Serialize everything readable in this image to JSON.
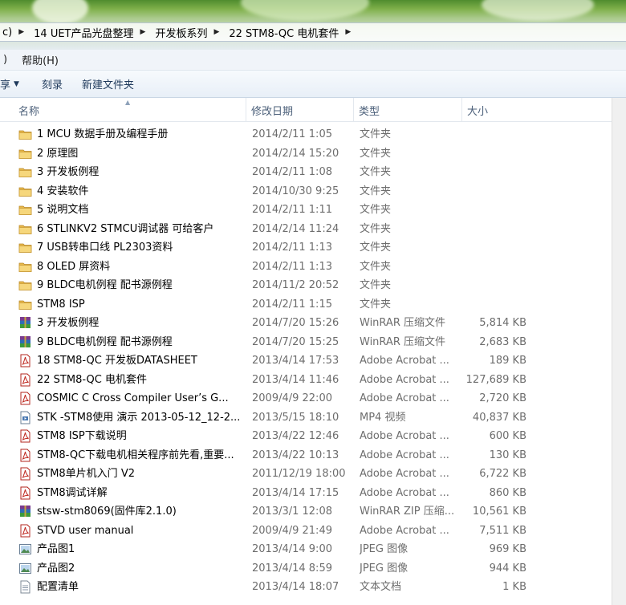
{
  "address": {
    "crumbs": [
      {
        "label": "c)"
      },
      {
        "label": "14 UET产品光盘整理"
      },
      {
        "label": "开发板系列"
      },
      {
        "label": "22 STM8-QC 电机套件"
      }
    ]
  },
  "menubar": {
    "items": [
      {
        "label": ")"
      },
      {
        "label": "帮助(H)"
      }
    ]
  },
  "toolbar": {
    "organize_fragment": "享",
    "burn": "刻录",
    "new_folder": "新建文件夹"
  },
  "columns": {
    "name": "名称",
    "date": "修改日期",
    "type": "类型",
    "size": "大小"
  },
  "files": [
    {
      "name": "1 MCU 数据手册及编程手册",
      "date": "2014/2/11 1:05",
      "type": "文件夹",
      "size": "",
      "icon": "folder-icon"
    },
    {
      "name": "2 原理图",
      "date": "2014/2/14 15:20",
      "type": "文件夹",
      "size": "",
      "icon": "folder-icon"
    },
    {
      "name": "3 开发板例程",
      "date": "2014/2/11 1:08",
      "type": "文件夹",
      "size": "",
      "icon": "folder-icon"
    },
    {
      "name": "4 安装软件",
      "date": "2014/10/30 9:25",
      "type": "文件夹",
      "size": "",
      "icon": "folder-icon"
    },
    {
      "name": "5 说明文档",
      "date": "2014/2/11 1:11",
      "type": "文件夹",
      "size": "",
      "icon": "folder-icon"
    },
    {
      "name": "6 STLINKV2 STMCU调试器 可给客户",
      "date": "2014/2/14 11:24",
      "type": "文件夹",
      "size": "",
      "icon": "folder-icon"
    },
    {
      "name": "7 USB转串口线 PL2303资料",
      "date": "2014/2/11 1:13",
      "type": "文件夹",
      "size": "",
      "icon": "folder-icon"
    },
    {
      "name": "8 OLED 屏资料",
      "date": "2014/2/11 1:13",
      "type": "文件夹",
      "size": "",
      "icon": "folder-icon"
    },
    {
      "name": "9 BLDC电机例程 配书源例程",
      "date": "2014/11/2 20:52",
      "type": "文件夹",
      "size": "",
      "icon": "folder-icon"
    },
    {
      "name": "STM8 ISP",
      "date": "2014/2/11 1:15",
      "type": "文件夹",
      "size": "",
      "icon": "folder-icon"
    },
    {
      "name": "3 开发板例程",
      "date": "2014/7/20 15:26",
      "type": "WinRAR 压缩文件",
      "size": "5,814 KB",
      "icon": "winrar-icon"
    },
    {
      "name": "9 BLDC电机例程 配书源例程",
      "date": "2014/7/20 15:25",
      "type": "WinRAR 压缩文件",
      "size": "2,683 KB",
      "icon": "winrar-icon"
    },
    {
      "name": "18 STM8-QC 开发板DATASHEET",
      "date": "2013/4/14 17:53",
      "type": "Adobe Acrobat ...",
      "size": "189 KB",
      "icon": "pdf-icon"
    },
    {
      "name": "22 STM8-QC 电机套件",
      "date": "2013/4/14 11:46",
      "type": "Adobe Acrobat ...",
      "size": "127,689 KB",
      "icon": "pdf-icon"
    },
    {
      "name": "COSMIC C Cross Compiler User’s G...",
      "date": "2009/4/9 22:00",
      "type": "Adobe Acrobat ...",
      "size": "2,720 KB",
      "icon": "pdf-icon"
    },
    {
      "name": "STK -STM8使用 演示 2013-05-12_12-2...",
      "date": "2013/5/15 18:10",
      "type": "MP4 视频",
      "size": "40,837 KB",
      "icon": "video-file-icon"
    },
    {
      "name": "STM8 ISP下载说明",
      "date": "2013/4/22 12:46",
      "type": "Adobe Acrobat ...",
      "size": "600 KB",
      "icon": "pdf-icon"
    },
    {
      "name": "STM8-QC下载电机相关程序前先看,重要...",
      "date": "2013/4/22 10:13",
      "type": "Adobe Acrobat ...",
      "size": "130 KB",
      "icon": "pdf-icon"
    },
    {
      "name": "STM8单片机入门 V2",
      "date": "2011/12/19 18:00",
      "type": "Adobe Acrobat ...",
      "size": "6,722 KB",
      "icon": "pdf-icon"
    },
    {
      "name": "STM8调试详解",
      "date": "2013/4/14 17:15",
      "type": "Adobe Acrobat ...",
      "size": "860 KB",
      "icon": "pdf-icon"
    },
    {
      "name": "stsw-stm8069(固件库2.1.0)",
      "date": "2013/3/1 12:08",
      "type": "WinRAR ZIP 压缩...",
      "size": "10,561 KB",
      "icon": "winrar-icon"
    },
    {
      "name": "STVD user manual",
      "date": "2009/4/9 21:49",
      "type": "Adobe Acrobat ...",
      "size": "7,511 KB",
      "icon": "pdf-icon"
    },
    {
      "name": "产品图1",
      "date": "2013/4/14 9:00",
      "type": "JPEG 图像",
      "size": "969 KB",
      "icon": "image-file-icon"
    },
    {
      "name": "产品图2",
      "date": "2013/4/14 8:59",
      "type": "JPEG 图像",
      "size": "944 KB",
      "icon": "image-file-icon"
    },
    {
      "name": "配置清单",
      "date": "2013/4/14 18:07",
      "type": "文本文档",
      "size": "1 KB",
      "icon": "text-file-icon"
    }
  ]
}
